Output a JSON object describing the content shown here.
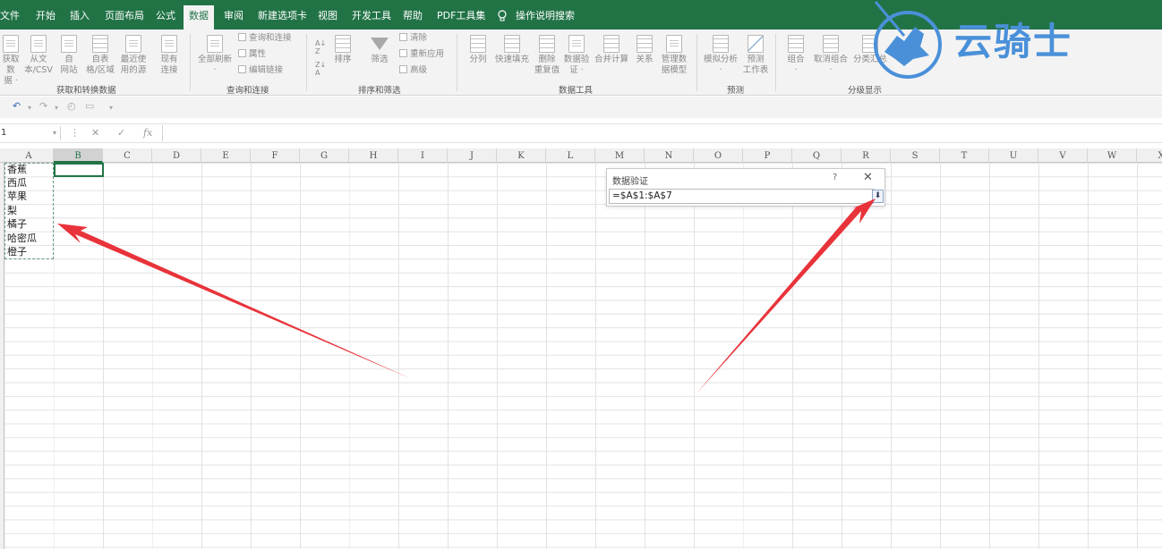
{
  "tabs": [
    {
      "label": "文件",
      "active": false
    },
    {
      "label": "开始",
      "active": false
    },
    {
      "label": "插入",
      "active": false
    },
    {
      "label": "页面布局",
      "active": false
    },
    {
      "label": "公式",
      "active": false
    },
    {
      "label": "数据",
      "active": true
    },
    {
      "label": "审阅",
      "active": false
    },
    {
      "label": "新建选项卡",
      "active": false
    },
    {
      "label": "视图",
      "active": false
    },
    {
      "label": "开发工具",
      "active": false
    },
    {
      "label": "帮助",
      "active": false
    },
    {
      "label": "PDF工具集",
      "active": false
    }
  ],
  "tell_me": "操作说明搜索",
  "ribbon": {
    "get_data": {
      "label1": "获取数",
      "label2": "据 ·"
    },
    "from_csv": {
      "label1": "从文",
      "label2": "本/CSV"
    },
    "from_web": {
      "label1": "自",
      "label2": "网站"
    },
    "from_table": {
      "label1": "自表",
      "label2": "格/区域"
    },
    "recent_sources": {
      "label1": "最近使",
      "label2": "用的源"
    },
    "existing_conn": {
      "label1": "现有",
      "label2": "连接"
    },
    "refresh_all": {
      "label1": "全部刷新",
      "label2": "·"
    },
    "queries_conn": "查询和连接",
    "properties": "属性",
    "edit_links": "编辑链接",
    "sort": "排序",
    "filter": "筛选",
    "clear": "清除",
    "reapply": "重新应用",
    "advanced": "高级",
    "text_to_columns": "分列",
    "flash_fill": "快速填充",
    "remove_dup": {
      "label1": "删除",
      "label2": "重复值"
    },
    "data_validation": {
      "label1": "数据验",
      "label2": "证 ·"
    },
    "consolidate": "合并计算",
    "relationships": "关系",
    "manage_model": {
      "label1": "管理数",
      "label2": "据模型"
    },
    "what_if": {
      "label1": "模拟分析",
      "label2": "·"
    },
    "forecast_sheet": {
      "label1": "预测",
      "label2": "工作表"
    },
    "group": {
      "label1": "组合",
      "label2": "·"
    },
    "ungroup": {
      "label1": "取消组合",
      "label2": "·"
    },
    "subtotal": "分类汇总",
    "groups": {
      "get_transform": "获取和转换数据",
      "queries": "查询和连接",
      "sort_filter": "排序和筛选",
      "data_tools": "数据工具",
      "forecast": "预测",
      "outline": "分级显示"
    }
  },
  "name_box": "1",
  "formula_bar": {
    "fx": "fx",
    "value": ""
  },
  "columns": [
    "A",
    "B",
    "C",
    "D",
    "E",
    "F",
    "G",
    "H",
    "I",
    "J",
    "K",
    "L",
    "M",
    "N",
    "O",
    "P",
    "Q",
    "R",
    "S",
    "T",
    "U",
    "V",
    "W",
    "X"
  ],
  "cells_a": [
    "香蕉",
    "西瓜",
    "苹果",
    "梨",
    "橘子",
    "哈密瓜",
    "橙子"
  ],
  "dialog": {
    "title": "数据验证",
    "help": "?",
    "close": "✕",
    "value": "=$A$1:$A$7",
    "collapse_btn": "⬇"
  },
  "watermark": "云骑士",
  "colors": {
    "ribbon_green": "#217346",
    "arrow_red": "#e8333a",
    "watermark_blue": "#4a90d9"
  }
}
